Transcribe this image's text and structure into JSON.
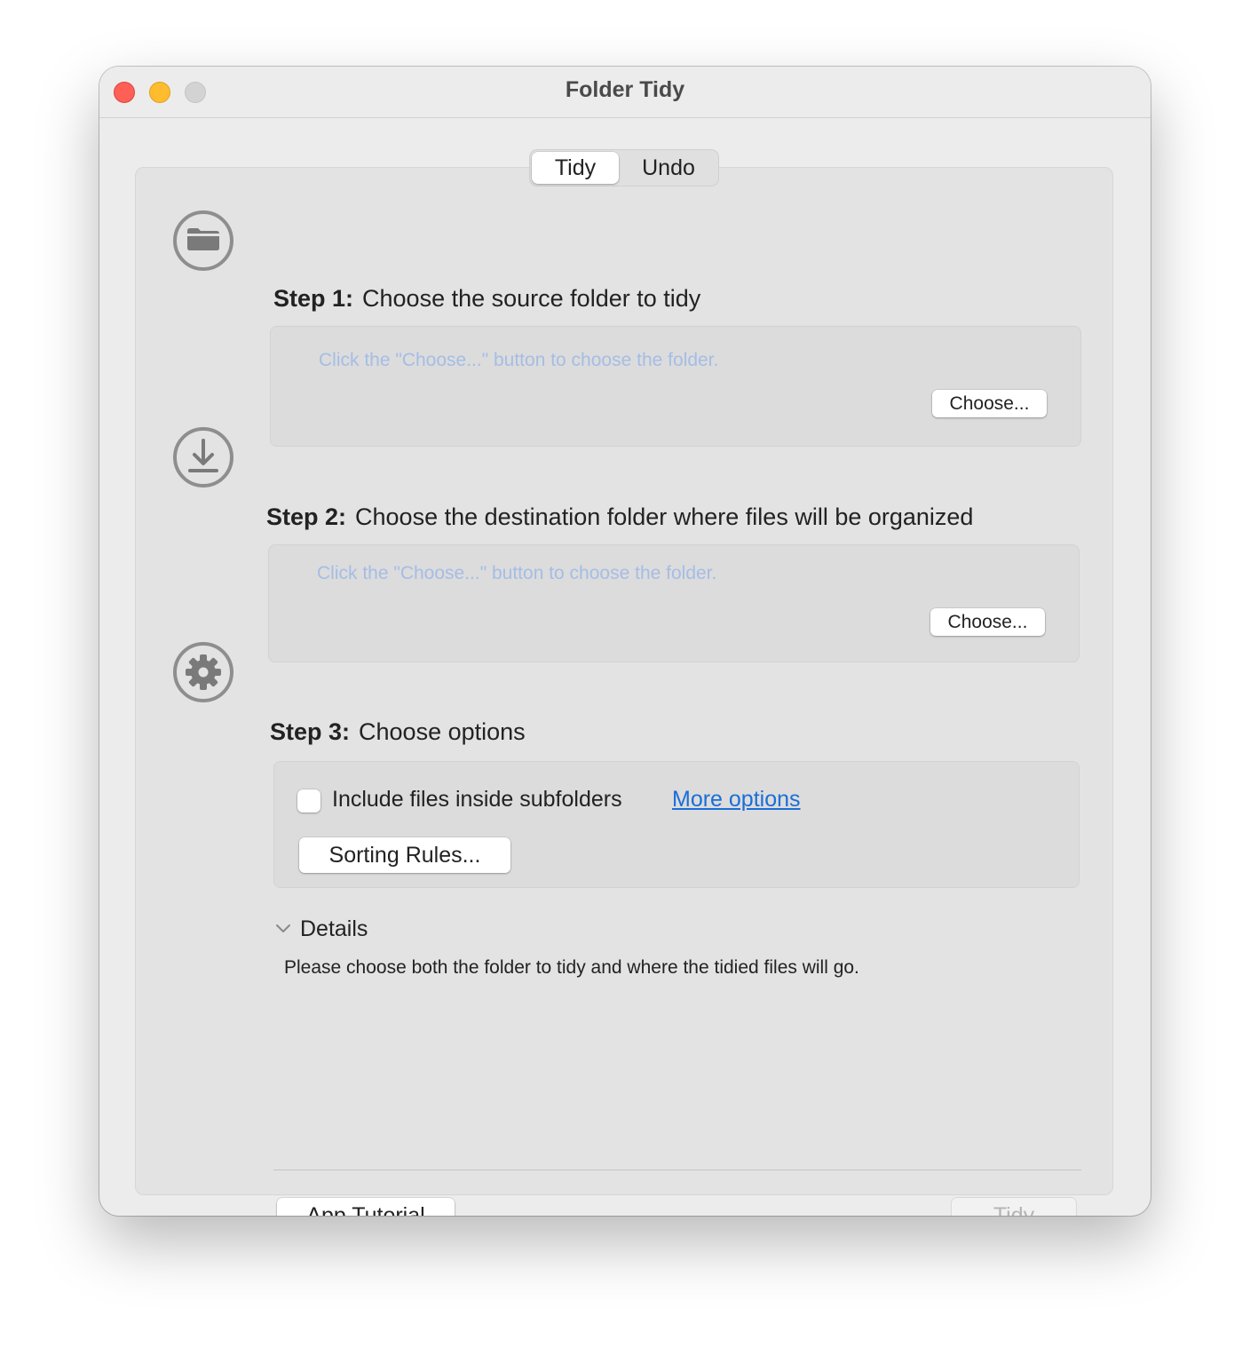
{
  "window": {
    "title": "Folder Tidy"
  },
  "tabs": [
    {
      "label": "Tidy",
      "selected": true
    },
    {
      "label": "Undo",
      "selected": false
    }
  ],
  "step1": {
    "prefix": "Step 1:",
    "title": "Choose the source folder to tidy",
    "hint": "Click the \"Choose...\" button to choose the folder.",
    "button": "Choose...",
    "icon": "folder-icon"
  },
  "step2": {
    "prefix": "Step 2:",
    "title": "Choose the destination folder where files will be organized",
    "hint": "Click the \"Choose...\" button to choose the folder.",
    "button": "Choose...",
    "icon": "download-icon"
  },
  "step3": {
    "prefix": "Step 3:",
    "title": "Choose options",
    "checkbox_label": "Include files inside subfolders",
    "checkbox_checked": false,
    "more_options": "More options",
    "sorting_rules": "Sorting Rules...",
    "icon": "gear-icon"
  },
  "details": {
    "label": "Details",
    "message": "Please choose both the folder to tidy and where the tidied files will go."
  },
  "footer": {
    "tutorial": "App Tutorial",
    "tidy": "Tidy"
  },
  "colors": {
    "close": "#fe5f57",
    "minimize": "#febc2e",
    "link": "#1a6ed8",
    "hint": "#a5bde5"
  }
}
